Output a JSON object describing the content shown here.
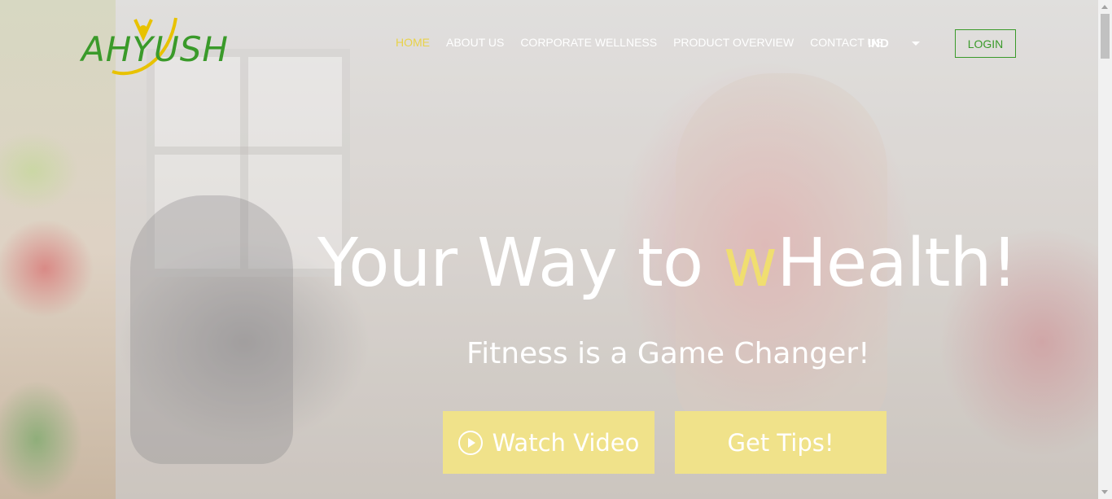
{
  "brand": {
    "logo_text": "AHYUSH"
  },
  "nav": {
    "items": [
      {
        "label": "HOME",
        "active": true
      },
      {
        "label": "ABOUT US",
        "active": false
      },
      {
        "label": "CORPORATE WELLNESS",
        "active": false
      },
      {
        "label": "PRODUCT OVERVIEW",
        "active": false
      },
      {
        "label": "CONTACT US",
        "active": false
      }
    ],
    "language": "IND",
    "login_label": "LOGIN"
  },
  "hero": {
    "headline_pre": "Your Way to ",
    "headline_accent": "w",
    "headline_post": "Health!",
    "subline": "Fitness is a Game Changer!",
    "watch_video_label": "Watch Video",
    "get_tips_label": "Get Tips!"
  },
  "colors": {
    "brand_green": "#3a9a2a",
    "accent_yellow": "#e8d24a",
    "cta_yellow": "#f0e28a"
  }
}
